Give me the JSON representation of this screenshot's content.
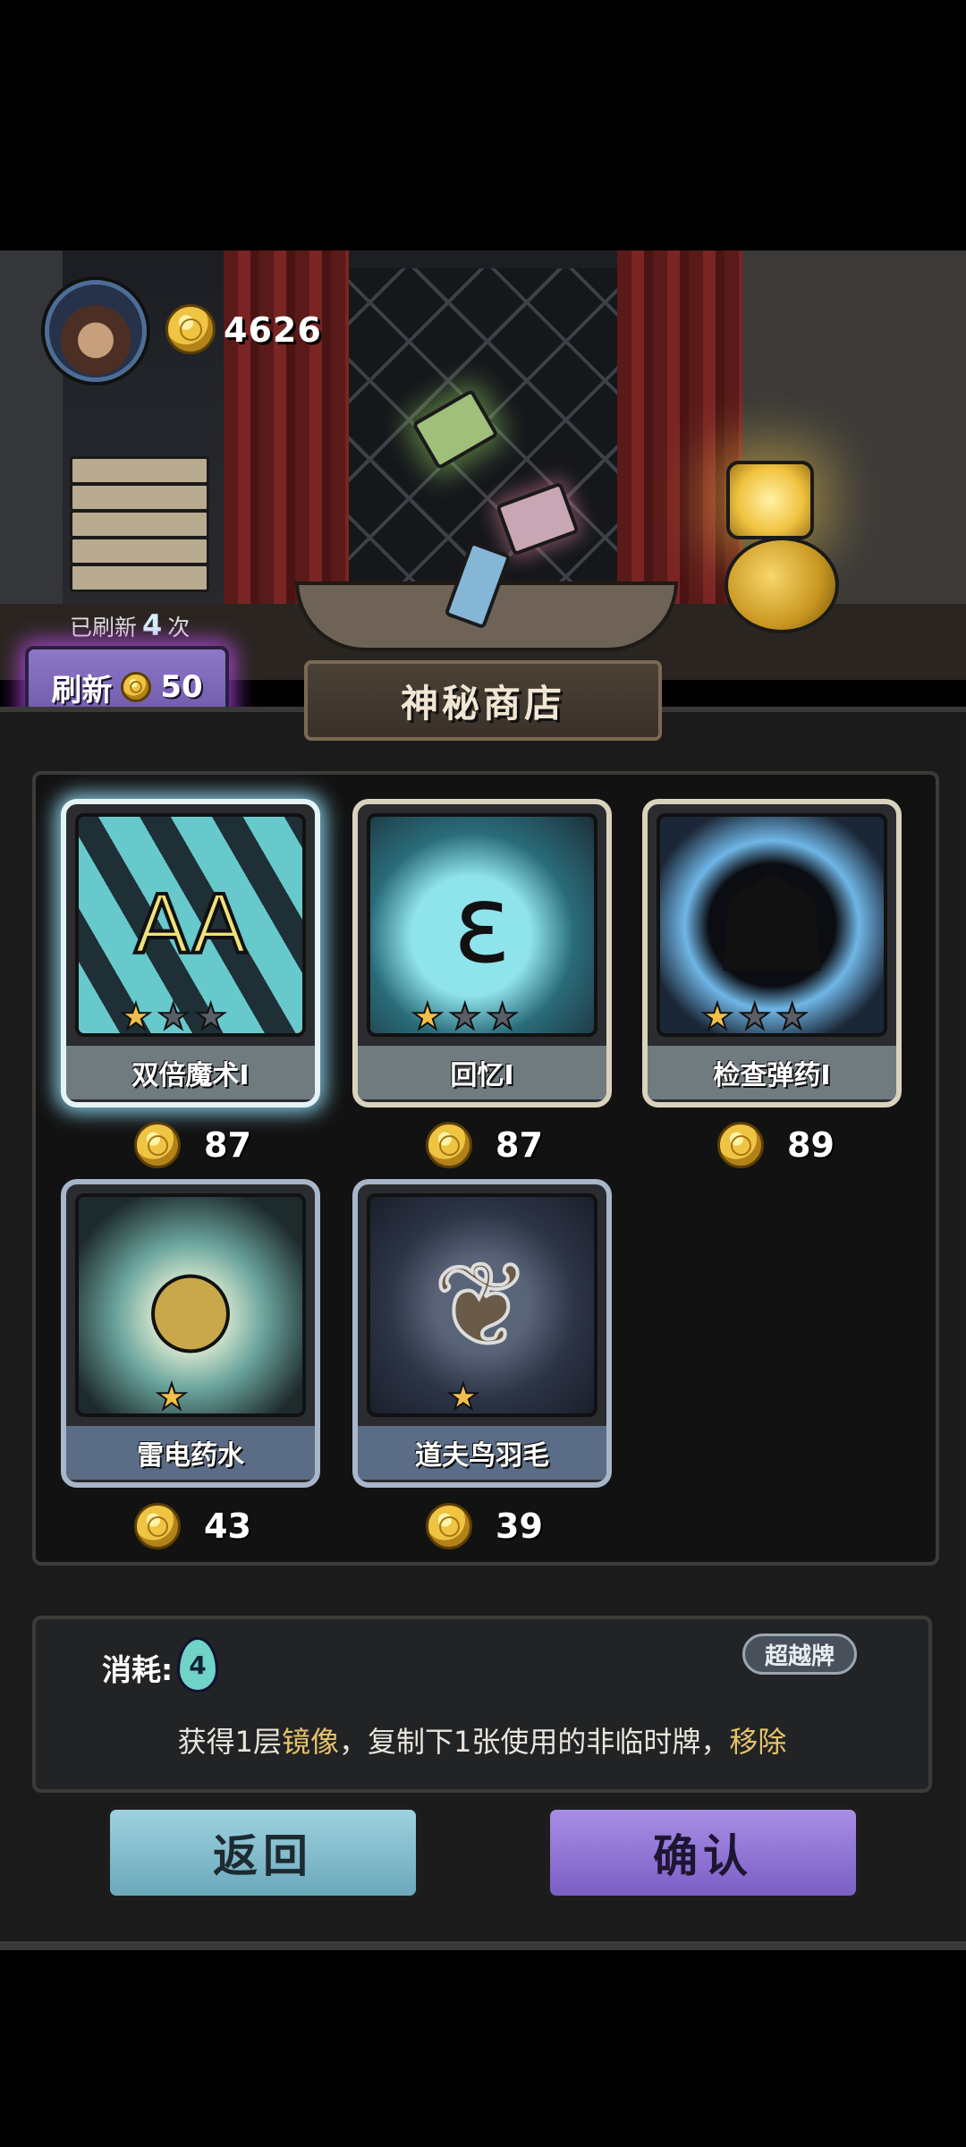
{
  "hud": {
    "gold": "4626"
  },
  "refresh": {
    "prefix": "已刷新",
    "count": "4",
    "suffix": "次",
    "label": "刷新",
    "cost": "50"
  },
  "shop": {
    "title": "神秘商店"
  },
  "cards": [
    {
      "name": "双倍魔术I",
      "price": "87",
      "stars": 1,
      "selected": true,
      "art_icon": "double-a-cards-icon"
    },
    {
      "name": "回忆I",
      "price": "87",
      "stars": 1,
      "selected": false,
      "art_icon": "swirl-memory-icon"
    },
    {
      "name": "检查弹药I",
      "price": "89",
      "stars": 1,
      "selected": false,
      "art_icon": "silhouette-ammo-icon"
    },
    {
      "name": "雷电药水",
      "price": "43",
      "stars": 1,
      "selected": false,
      "art_icon": "lightning-potion-icon"
    },
    {
      "name": "道夫鸟羽毛",
      "price": "39",
      "stars": 1,
      "selected": false,
      "art_icon": "feather-icon"
    }
  ],
  "detail": {
    "cost_label": "消耗:",
    "cost_value": "4",
    "tag": "超越牌",
    "desc_a": "获得1层",
    "desc_hl1": "镜像",
    "desc_b": "，复制下1张使用的非临时牌，",
    "desc_hl2": "移除"
  },
  "buttons": {
    "back": "返回",
    "confirm": "确认"
  },
  "colors": {
    "highlight": "#e6c36b",
    "refresh_glow": "#c850ff",
    "selected_glow": "#96e6ff"
  }
}
